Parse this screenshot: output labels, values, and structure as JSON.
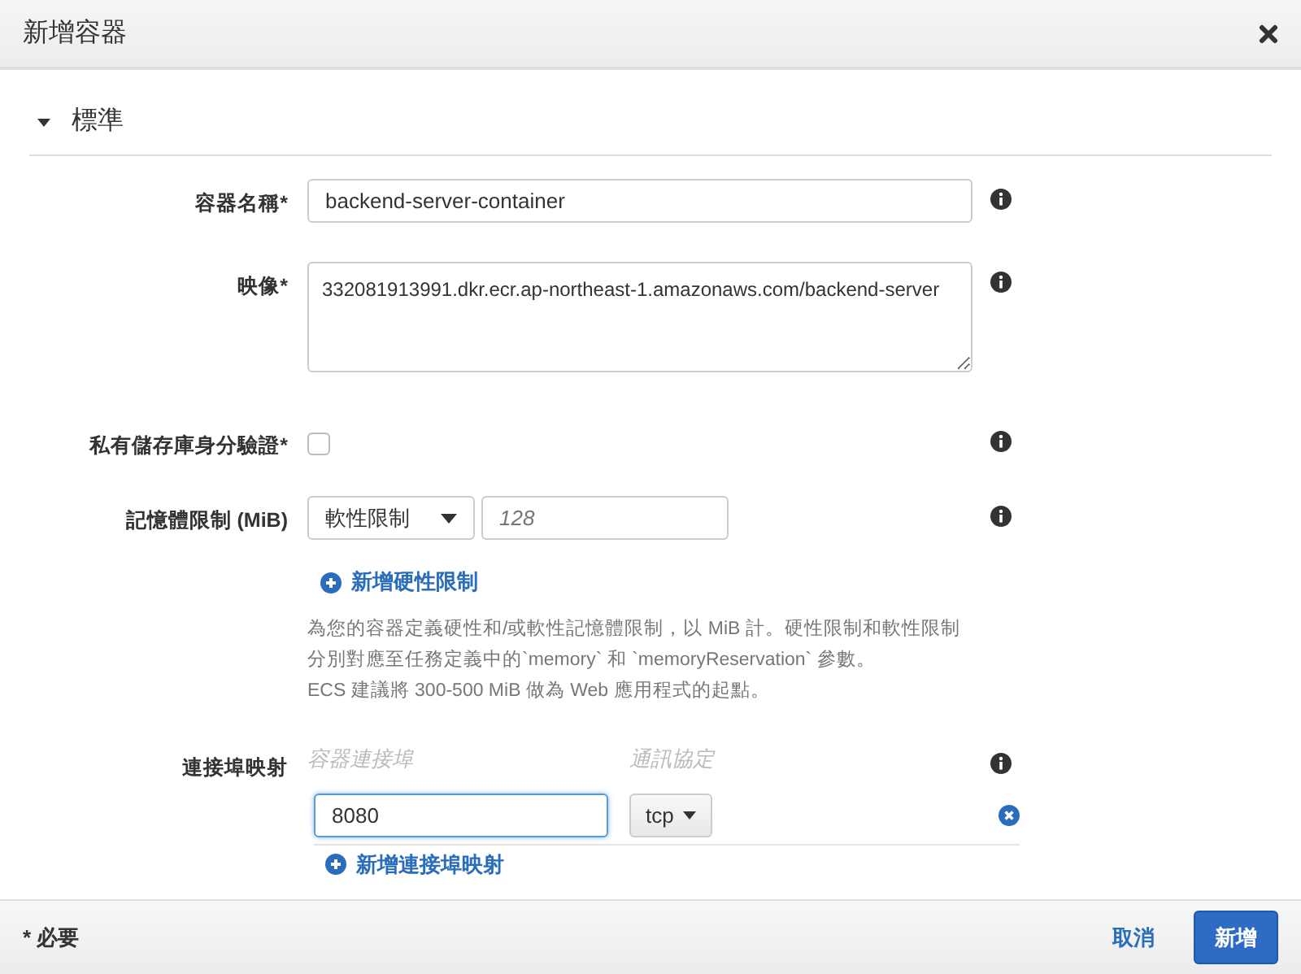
{
  "dialog": {
    "title": "新增容器"
  },
  "section": {
    "title": "標準",
    "expanded": true
  },
  "fields": [
    {
      "kind": "text",
      "label": "容器名稱*",
      "value": "backend-server-container"
    },
    {
      "kind": "textarea",
      "label": "映像*",
      "value": "332081913991.dkr.ecr.ap-northeast-1.amazonaws.com/backend-server"
    },
    {
      "kind": "checkbox",
      "label": "私有儲存庫身分驗證*",
      "checked": false
    },
    {
      "kind": "memory",
      "label": "記憶體限制 (MiB)",
      "select": "軟性限制",
      "placeholder": "128",
      "link": "新增硬性限制",
      "help": [
        "為您的容器定義硬性和/或軟性記憶體限制，以 MiB 計。硬性限制和軟性限制分別對應至任務定義中的`memory` 和 `memoryReservation` 參數。",
        "ECS 建議將 300-500 MiB 做為 Web 應用程式的起點。"
      ]
    },
    {
      "kind": "ports",
      "label": "連接埠映射",
      "columns": [
        "容器連接埠",
        "通訊協定"
      ],
      "rows": [
        {
          "port": "8080",
          "protocol": "tcp",
          "focused": true
        }
      ],
      "link": "新增連接埠映射"
    }
  ],
  "footer": {
    "note": "* 必要",
    "cancel": "取消",
    "submit": "新增"
  }
}
